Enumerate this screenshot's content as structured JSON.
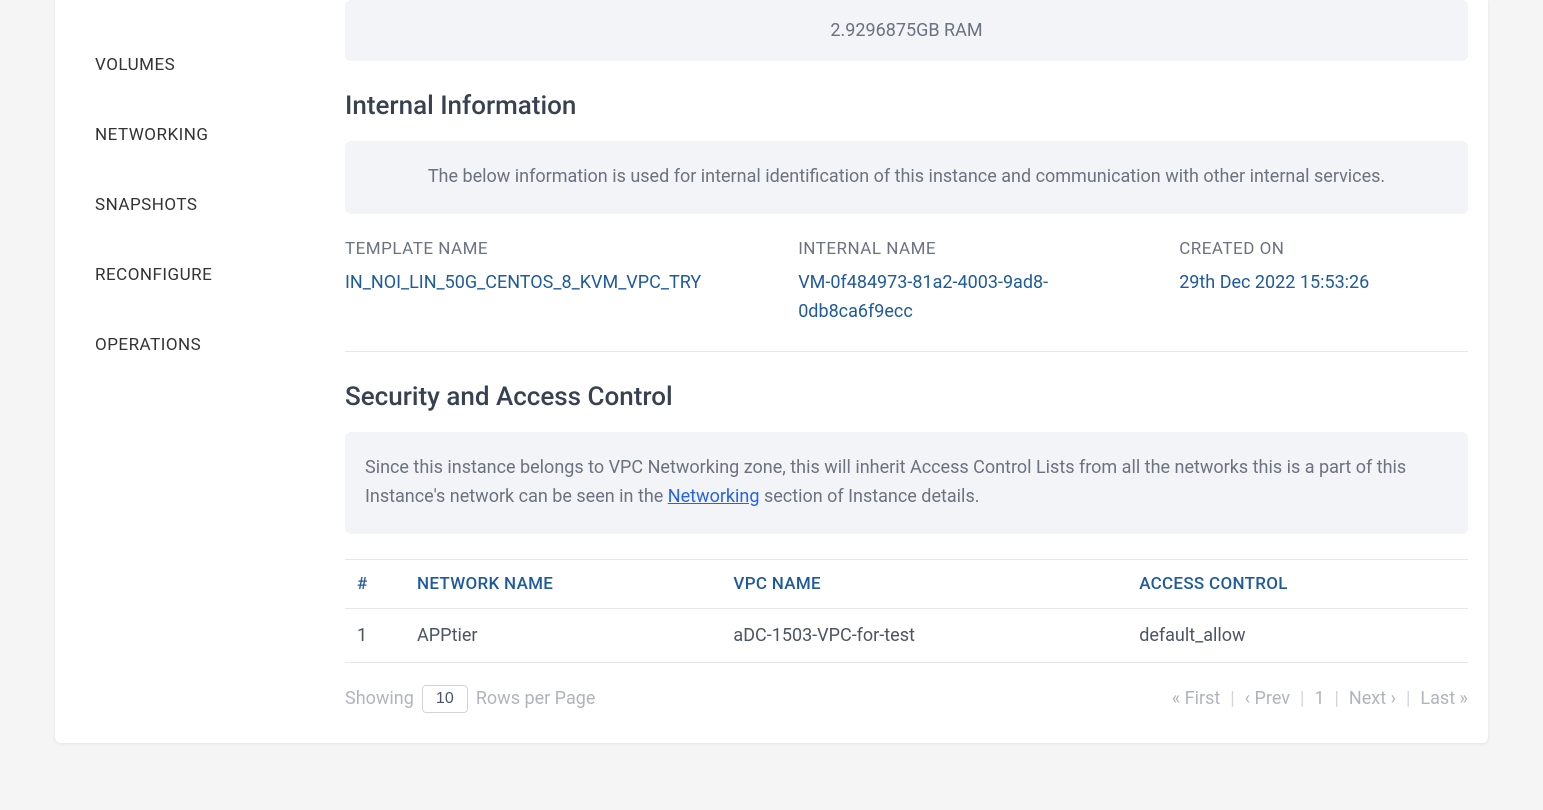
{
  "sidebar": {
    "items": [
      {
        "label": "VOLUMES"
      },
      {
        "label": "NETWORKING"
      },
      {
        "label": "SNAPSHOTS"
      },
      {
        "label": "RECONFIGURE"
      },
      {
        "label": "OPERATIONS"
      }
    ]
  },
  "topInfo": {
    "ram": "2.9296875GB RAM"
  },
  "internal": {
    "heading": "Internal Information",
    "description": "The below information is used for internal identification of this instance and communication with other internal services.",
    "templateLabel": "TEMPLATE NAME",
    "templateValue": "IN_NOI_LIN_50G_CENTOS_8_KVM_VPC_TRY",
    "internalNameLabel": "INTERNAL NAME",
    "internalNameValue": "VM-0f484973-81a2-4003-9ad8-0db8ca6f9ecc",
    "createdLabel": "CREATED ON",
    "createdValue": "29th Dec 2022 15:53:26"
  },
  "security": {
    "heading": "Security and Access Control",
    "descPre": "Since this instance belongs to VPC Networking zone, this will inherit Access Control Lists from all the networks this is a part of this Instance's network can be seen in the ",
    "linkText": "Networking",
    "descPost": " section of Instance details.",
    "columns": {
      "index": "#",
      "network": "NETWORK NAME",
      "vpc": "VPC NAME",
      "access": "ACCESS CONTROL"
    },
    "rows": [
      {
        "index": "1",
        "network": "APPtier",
        "vpc": "aDC-1503-VPC-for-test",
        "access": "default_allow"
      }
    ]
  },
  "pagination": {
    "showing": "Showing",
    "rowsValue": "10",
    "rowsPerPage": "Rows per Page",
    "first": "First",
    "prev": "Prev",
    "page": "1",
    "next": "Next",
    "last": "Last"
  }
}
